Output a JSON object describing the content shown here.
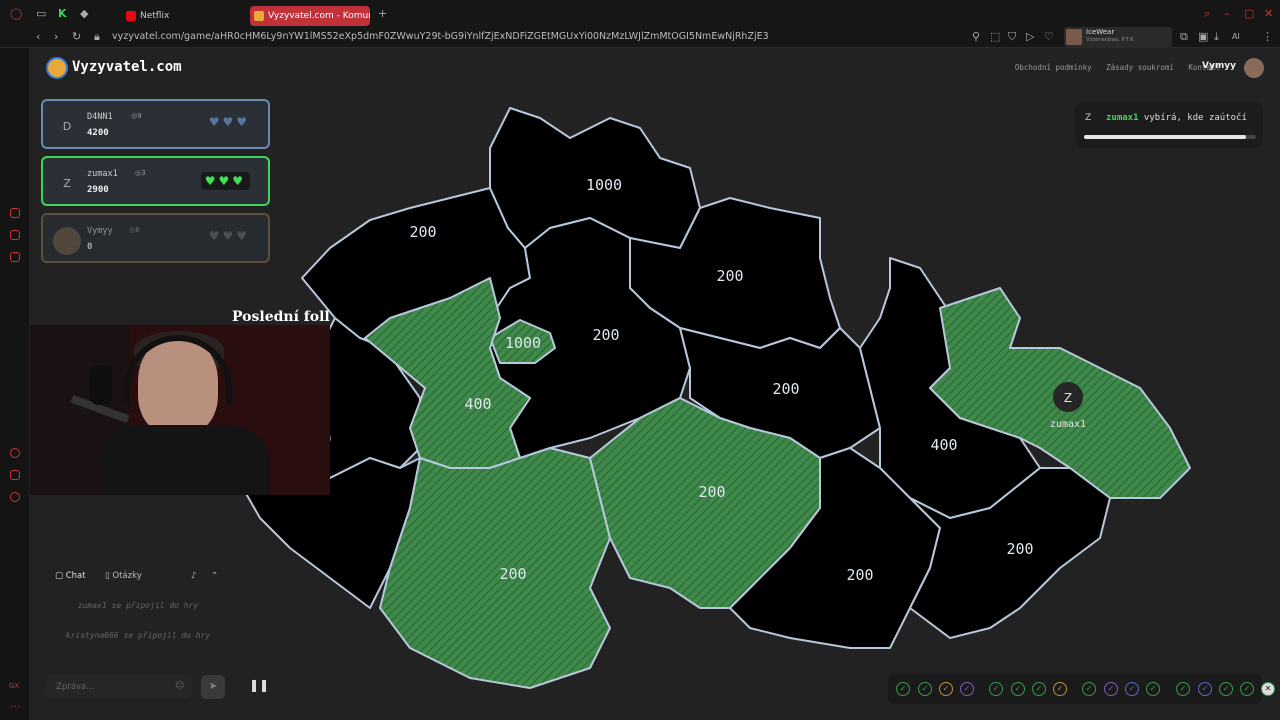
{
  "browser": {
    "tabs": [
      {
        "label": "Netflix"
      },
      {
        "label": "Vyzyvatel.com - Komunitní"
      }
    ],
    "new_tab_label": "+",
    "url": "vyzyvatel.com/game/aHR0cHM6Ly9nYW1lMS52eXp5dmF0ZWwuY29t-bG9iYnlfZjExNDFiZGEtMGUxYi00NzMzLWJlZmMtOGI5NmEwNjRhZjE3",
    "profile_name": "IceWear",
    "profile_sub": "Vzomenbas, P.T.K",
    "ai_label": "AI"
  },
  "header": {
    "logo_text": "Vyzyvatel.com",
    "links": [
      "Obchodní podmínky",
      "Zásady soukromí",
      "Kontakt"
    ],
    "user_name": "Vymyy"
  },
  "players": [
    {
      "initial": "D",
      "name": "D4NN1",
      "num": "9",
      "score": "4200",
      "hearts": "♥♥♥"
    },
    {
      "initial": "Z",
      "name": "zumax1",
      "num": "3",
      "score": "2900",
      "hearts": "♥♥♥"
    },
    {
      "initial": "",
      "name": "Vymyy",
      "num": "8",
      "score": "0",
      "hearts": "♥♥♥"
    }
  ],
  "overlay_text": "Poslední foll",
  "status": {
    "initial": "Z",
    "player": "zumax1",
    "text": " vybírá, kde zaútočí",
    "progress": 0.94
  },
  "map": {
    "regions": [
      {
        "value": "200",
        "owner": "blue"
      },
      {
        "value": "1000",
        "owner": "blue"
      },
      {
        "value": "200",
        "owner": "blue"
      },
      {
        "value": "1000",
        "owner": "green"
      },
      {
        "value": "200",
        "owner": "blue"
      },
      {
        "value": "400",
        "owner": "green"
      },
      {
        "value": "400",
        "owner": "blue"
      },
      {
        "value": "200",
        "owner": "blue"
      },
      {
        "value": "200",
        "owner": "green"
      },
      {
        "value": "200",
        "owner": "green"
      },
      {
        "value": "400",
        "owner": "blue"
      },
      {
        "value": "200",
        "owner": "blue"
      },
      {
        "value": "200",
        "owner": "blue"
      }
    ],
    "marker_initial": "Z",
    "marker_name": "zumax1",
    "colors": {
      "blue": "#3563a6",
      "green": "#3f8a4a",
      "border": "#b8c8dc"
    }
  },
  "chat": {
    "tab_chat": "Chat",
    "tab_questions": "Otázky",
    "messages": [
      "zumax1 se připojil do hry",
      "kristyna666 se připojil do hry"
    ],
    "input_placeholder": "Zpráva..."
  },
  "badges_count": 17
}
